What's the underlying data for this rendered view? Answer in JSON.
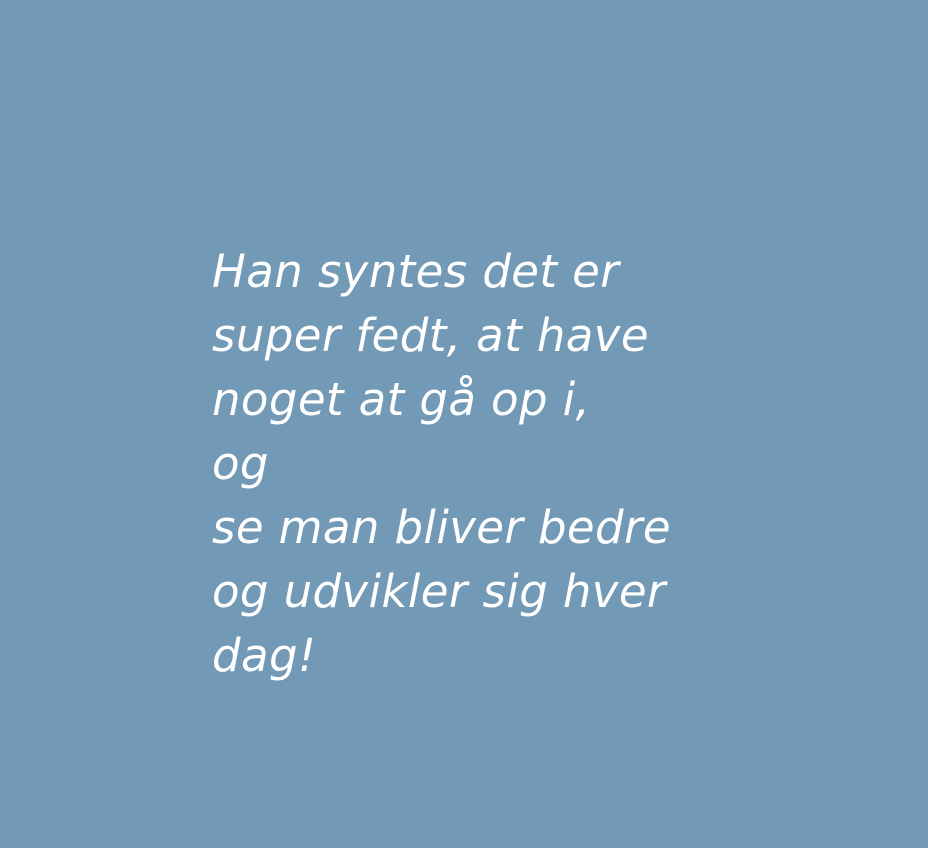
{
  "colors": {
    "background": "#7299b5",
    "text": "#ffffff"
  },
  "quote": {
    "lines": [
      "Han syntes det er",
      "super fedt, at have",
      "noget at gå op i,",
      "og",
      "se man bliver bedre",
      "og udvikler sig hver",
      "dag!"
    ]
  }
}
